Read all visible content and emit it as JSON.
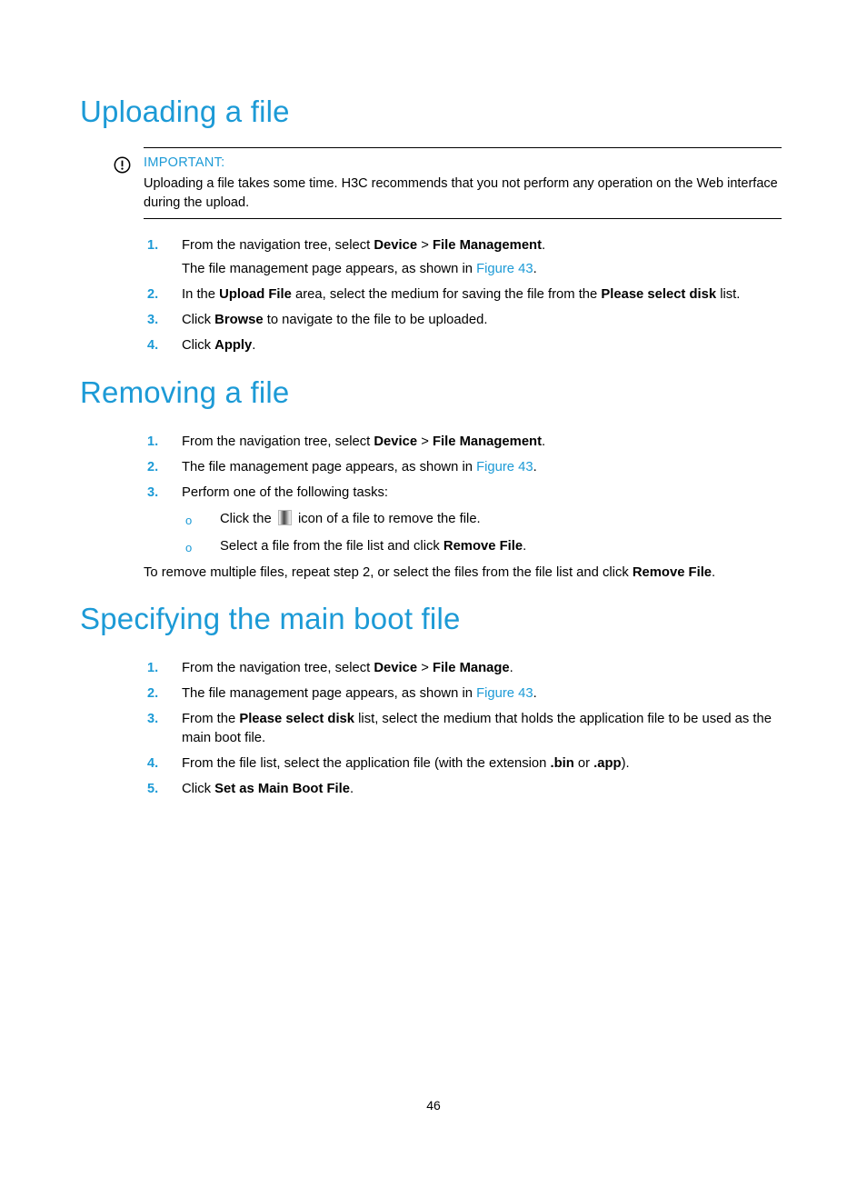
{
  "colors": {
    "heading_blue": "#1C9AD6",
    "xref_blue": "#1C9AD6",
    "body_black": "#000000"
  },
  "sections": [
    {
      "id": "uploading",
      "title": "Uploading a file"
    },
    {
      "id": "removing",
      "title": "Removing a file"
    },
    {
      "id": "specifying",
      "title": "Specifying the main boot file"
    }
  ],
  "note": {
    "icon": "exclamation-circle-icon",
    "label": "IMPORTANT:",
    "body": "Uploading a file takes some time. H3C recommends that you not perform any operation on the Web interface during the upload."
  },
  "uploading_steps": {
    "step1": {
      "num": "1.",
      "text_a": "From the navigation tree, select ",
      "bold_a": "Device",
      "text_b": " > ",
      "bold_b": "File Management",
      "text_c": ".",
      "sub_a": "The file management page appears, as shown in ",
      "xref": "Figure 43",
      "sub_b": "."
    },
    "step2": {
      "num": "2.",
      "text_a": "In the ",
      "bold_a": "Upload File",
      "text_b": " area, select the medium for saving the file from the ",
      "bold_b": "Please select disk",
      "text_c": " list."
    },
    "step3": {
      "num": "3.",
      "text_a": "Click ",
      "bold_a": "Browse",
      "text_b": " to navigate to the file to be uploaded."
    },
    "step4": {
      "num": "4.",
      "text_a": "Click ",
      "bold_a": "Apply",
      "text_b": "."
    }
  },
  "removing_steps": {
    "step1": {
      "num": "1.",
      "text_a": "From the navigation tree, select ",
      "bold_a": "Device",
      "text_b": " > ",
      "bold_b": "File Management",
      "text_c": "."
    },
    "step2": {
      "num": "2.",
      "text_a": "The file management page appears, as shown in ",
      "xref": "Figure 43",
      "text_b": "."
    },
    "step3": {
      "num": "3.",
      "text_a": "Perform one of the following tasks:",
      "bullets": {
        "bullet1": {
          "marker": "o",
          "text_a": "Click the ",
          "icon": "trash-icon",
          "text_b": " icon of a file to remove the file."
        },
        "bullet2": {
          "marker": "o",
          "text_a": "Select a file from the file list and click ",
          "bold_a": "Remove File",
          "text_b": "."
        }
      }
    }
  },
  "removing_trailing": {
    "text_a": "To remove multiple files, repeat step 2, or select the files from the file list and click ",
    "bold_a": "Remove File",
    "text_b": "."
  },
  "specifying_steps": {
    "step1": {
      "num": "1.",
      "text_a": "From the navigation tree, select ",
      "bold_a": "Device",
      "text_b": " > ",
      "bold_b": "File Manage",
      "text_c": "."
    },
    "step2": {
      "num": "2.",
      "text_a": "The file management page appears, as shown in ",
      "xref": "Figure 43",
      "text_b": "."
    },
    "step3": {
      "num": "3.",
      "text_a": "From the ",
      "bold_a": "Please select disk",
      "text_b": " list, select the medium that holds the application file to be used as the main boot file."
    },
    "step4": {
      "num": "4.",
      "text_a": "From the file list, select the application file (with the extension ",
      "bold_a": ".bin",
      "text_b": " or ",
      "bold_b": ".app",
      "text_c": ")."
    },
    "step5": {
      "num": "5.",
      "text_a": "Click ",
      "bold_a": "Set as Main Boot File",
      "text_b": "."
    }
  },
  "footer": {
    "page_number": "46"
  }
}
